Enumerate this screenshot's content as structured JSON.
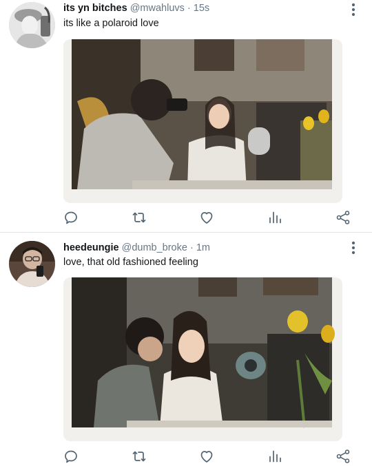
{
  "tweets": [
    {
      "name": "its yn bitches",
      "handle": "@mwahluvs",
      "separator": "·",
      "time": "15s",
      "text": "its like a polaroid love"
    },
    {
      "name": "heedeungie",
      "handle": "@dumb_broke",
      "separator": "·",
      "time": "1m",
      "text": "love, that old fashioned feeling"
    }
  ],
  "icons": {
    "more": "more-vertical-icon",
    "reply": "reply-icon",
    "retweet": "retweet-icon",
    "like": "heart-icon",
    "stats": "analytics-icon",
    "share": "share-icon"
  },
  "colors": {
    "text": "#14171a",
    "secondary": "#657786",
    "icon": "#536471",
    "divider": "#e1e6ea"
  }
}
